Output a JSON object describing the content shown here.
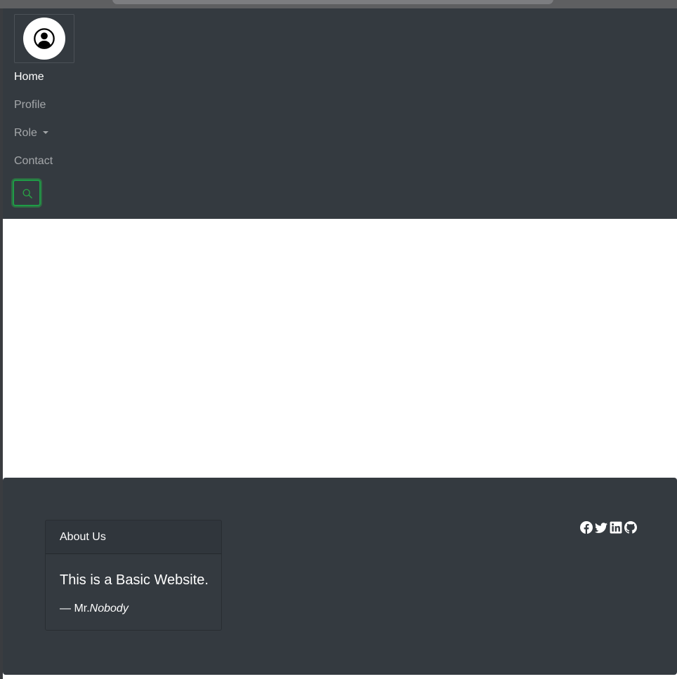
{
  "nav": {
    "links": [
      {
        "label": "Home",
        "active": true
      },
      {
        "label": "Profile",
        "active": false
      },
      {
        "label": "Role",
        "active": false,
        "dropdown": true
      },
      {
        "label": "Contact",
        "active": false
      }
    ],
    "brand_icon": "person-circle-icon",
    "search_icon": "search-icon"
  },
  "footer": {
    "card_title": "About Us",
    "quote": "This is a Basic Website.",
    "quote_prefix": "— Mr.",
    "quote_author": "Nobody",
    "social_icons": [
      "facebook-icon",
      "twitter-icon",
      "linkedin-icon",
      "github-icon"
    ]
  },
  "colors": {
    "navbar_bg": "#343a40",
    "accent_green": "#28a745",
    "page_bg": "#ffffff"
  }
}
